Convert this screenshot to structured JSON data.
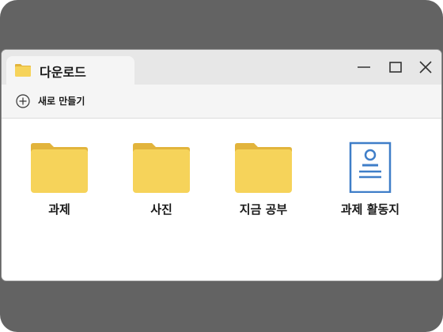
{
  "window": {
    "tab": {
      "title": "다운로드",
      "icon": "folder-icon"
    },
    "controls": {
      "minimize": "minimize-icon",
      "maximize": "maximize-icon",
      "close": "close-icon"
    }
  },
  "toolbar": {
    "new_label": "새로 만들기",
    "new_icon": "plus-circle-icon"
  },
  "items": [
    {
      "name": "과제",
      "type": "folder",
      "icon": "folder-icon"
    },
    {
      "name": "사진",
      "type": "folder",
      "icon": "folder-icon"
    },
    {
      "name": "지금 공부",
      "type": "folder",
      "icon": "folder-icon"
    },
    {
      "name": "과제 활동지",
      "type": "document",
      "icon": "document-icon"
    }
  ],
  "colors": {
    "folder": "#f6d35a",
    "folder_tab": "#e2b43c",
    "document": "#3f7ec8",
    "frame": "#636363",
    "titlebar": "#e7e7e7"
  }
}
